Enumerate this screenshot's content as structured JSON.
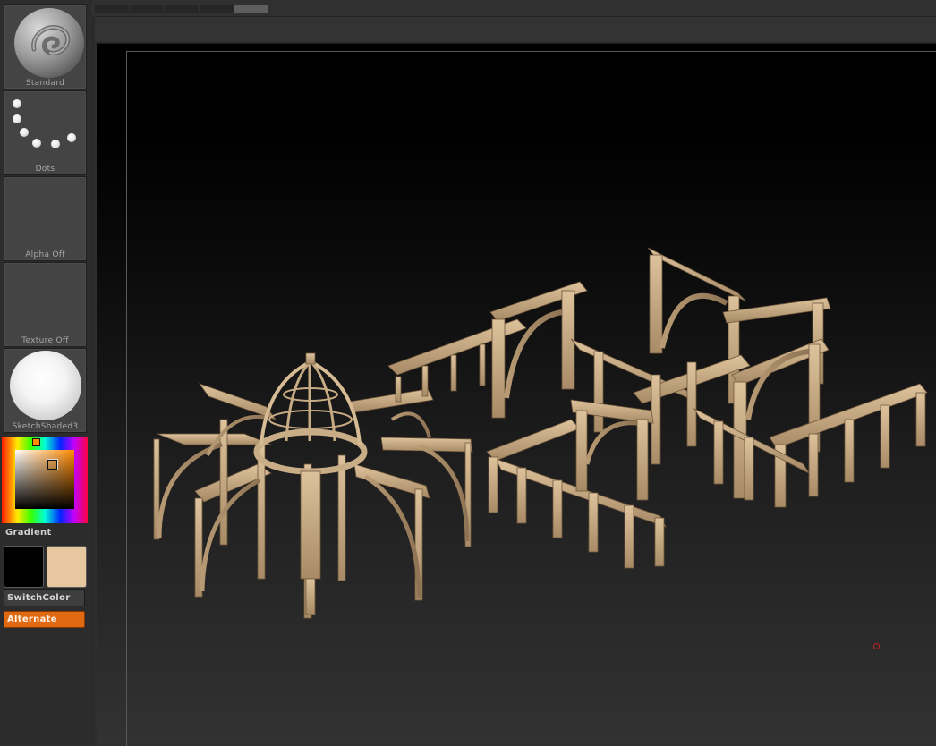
{
  "palette": {
    "brush": {
      "label": "Standard",
      "icon": "standard-brush-icon"
    },
    "stroke": {
      "label": "Dots",
      "icon": "dots-stroke-icon"
    },
    "alpha": {
      "label": "Alpha Off"
    },
    "texture": {
      "label": "Texture Off"
    },
    "material": {
      "label": "SketchShaded3",
      "icon": "material-sphere-icon"
    },
    "color_picker": {
      "selected_hue": "#ff8a00"
    },
    "gradient_label": "Gradient",
    "main_color": "#000000",
    "secondary_color": "#e7c7a0",
    "switch_color_label": "SwitchColor",
    "alternate_label": "Alternate"
  },
  "top_tabs": [
    "",
    "",
    "",
    "",
    ""
  ],
  "canvas": {
    "model_color": "#cdb28c",
    "cursor_color": "#c42020"
  }
}
